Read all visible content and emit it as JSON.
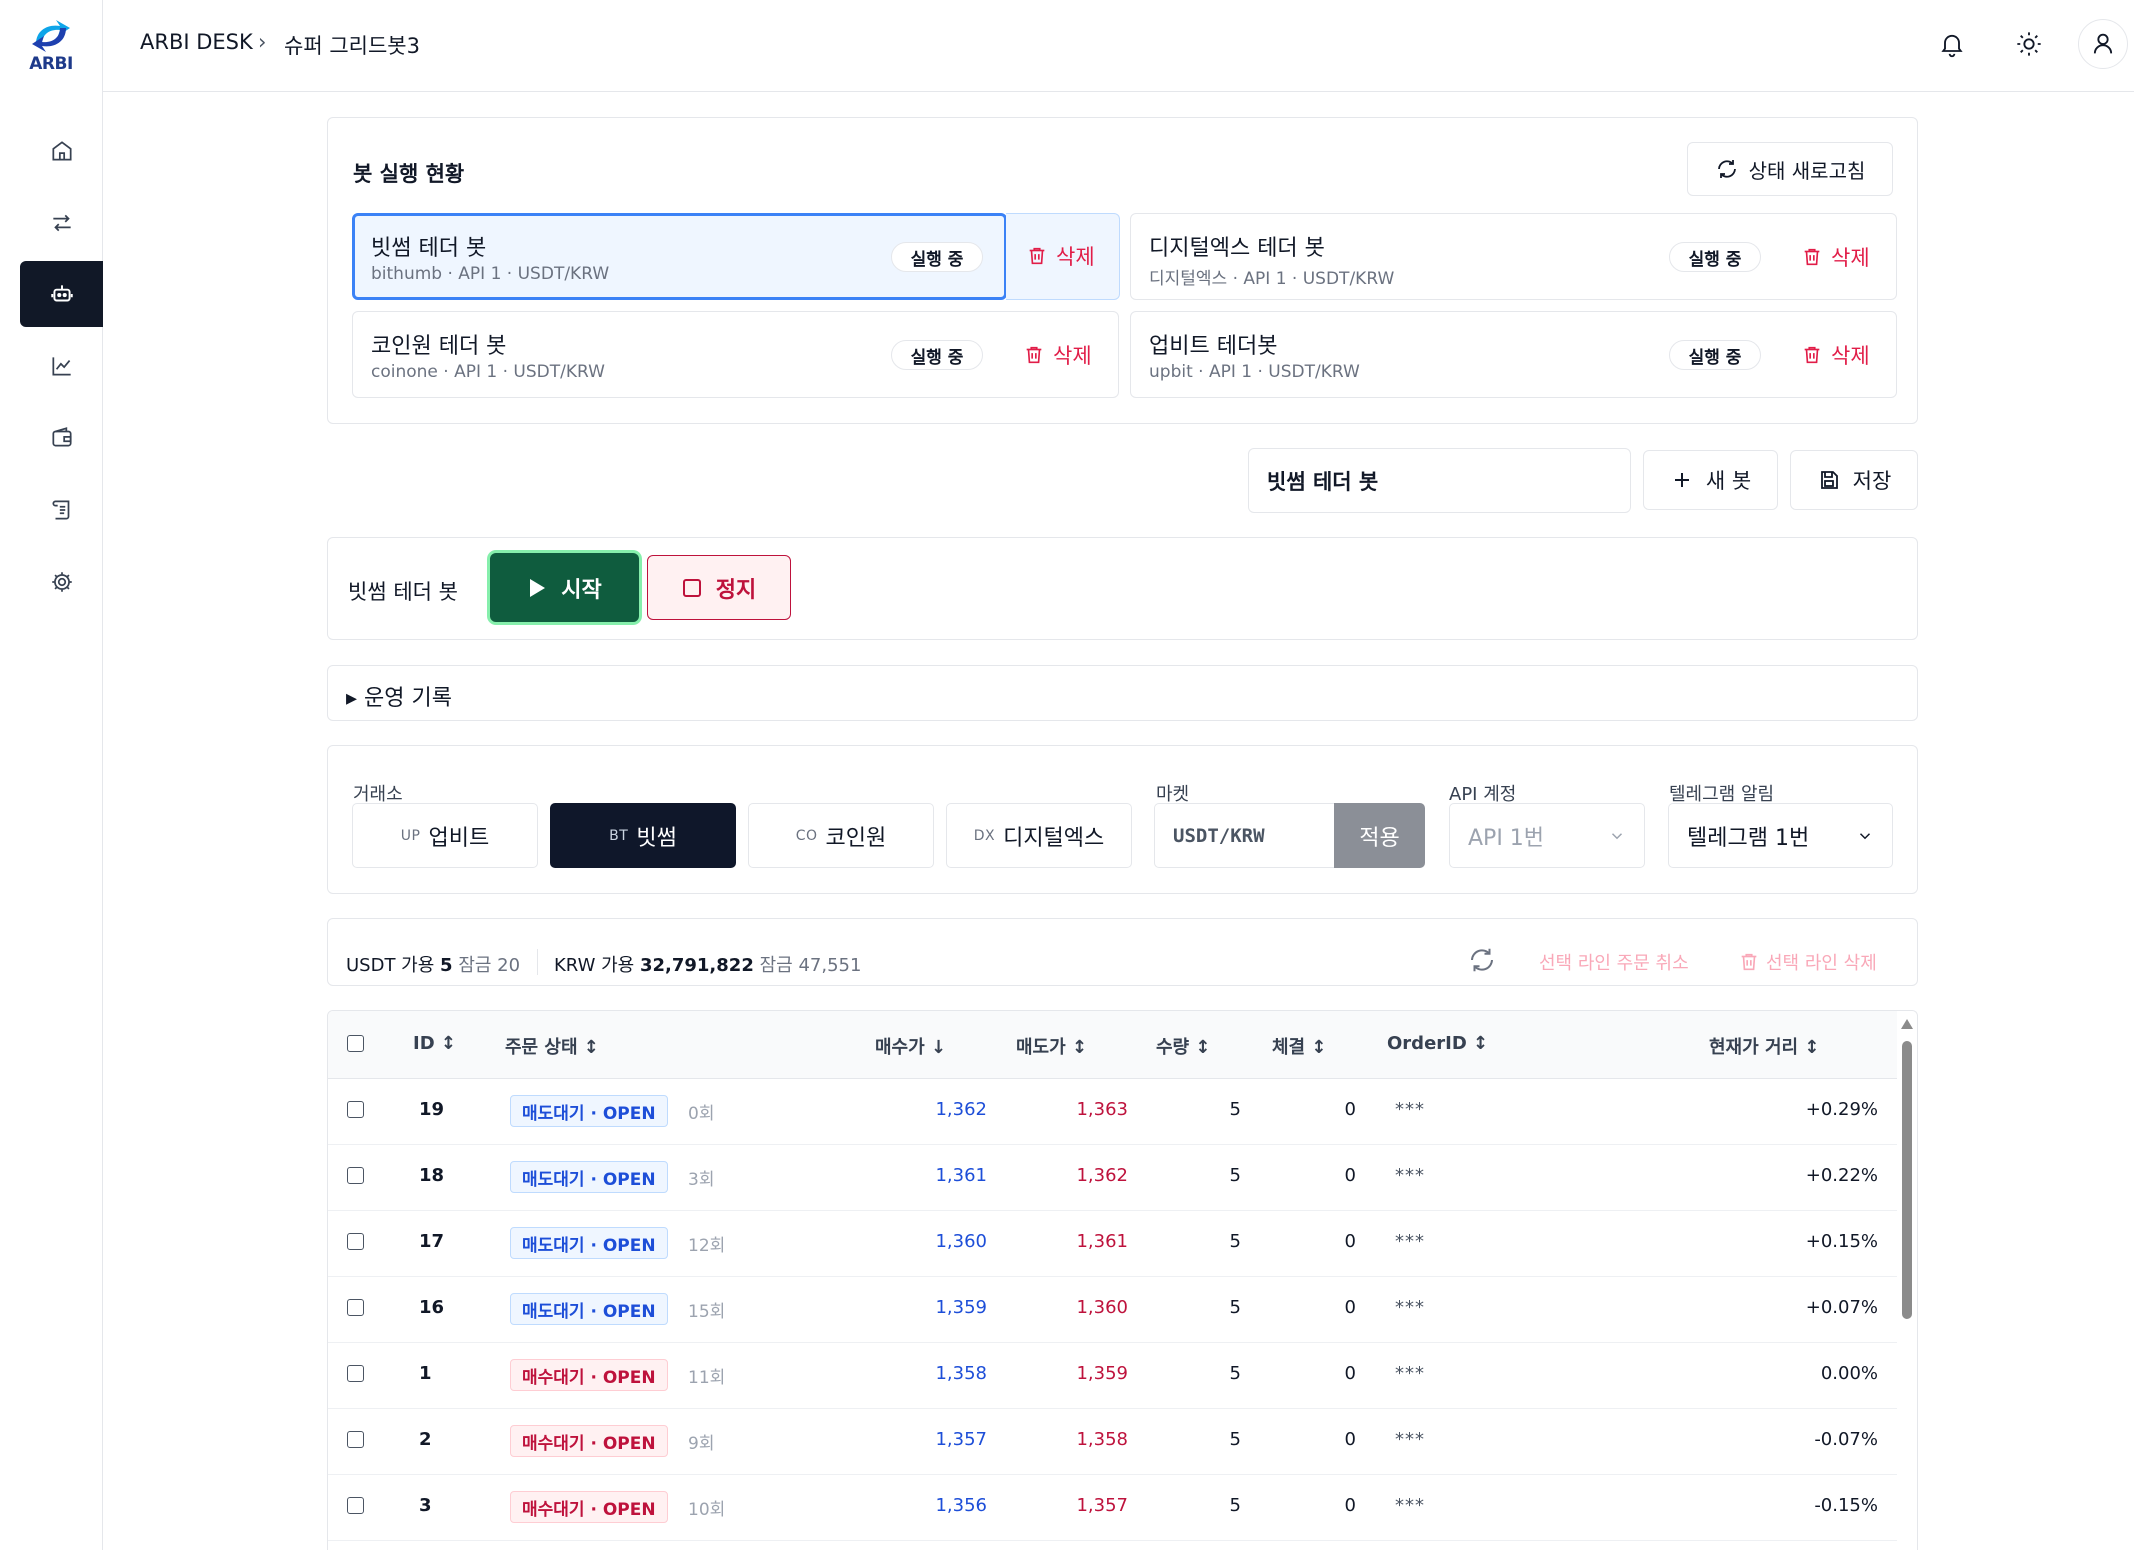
{
  "brand": {
    "logo_text": "ARBI"
  },
  "header": {
    "app_name": "ARBI DESK",
    "page": "슈퍼 그리드봇3"
  },
  "status_panel": {
    "title": "봇 실행 현황",
    "refresh_label": "상태 새로고침",
    "bots": [
      {
        "name": "빗썸 테더 봇",
        "sub": "bithumb · API 1 · USDT/KRW",
        "status": "실행 중",
        "delete": "삭제",
        "selected": true
      },
      {
        "name": "디지털엑스 테더 봇",
        "sub": "디지털엑스 · API 1 · USDT/KRW",
        "status": "실행 중",
        "delete": "삭제",
        "selected": false
      },
      {
        "name": "코인원 테더 봇",
        "sub": "coinone · API 1 · USDT/KRW",
        "status": "실행 중",
        "delete": "삭제",
        "selected": false
      },
      {
        "name": "업비트 테더봇",
        "sub": "upbit · API 1 · USDT/KRW",
        "status": "실행 중",
        "delete": "삭제",
        "selected": false
      }
    ]
  },
  "toolbar": {
    "bot_name_value": "빗썸 테더 봇",
    "new_bot_label": "새 봇",
    "save_label": "저장"
  },
  "control": {
    "label": "빗썸 테더 봇",
    "start_label": "시작",
    "stop_label": "정지"
  },
  "ops_log": {
    "label": "▸ 운영 기록"
  },
  "settings": {
    "exchange_label": "거래소",
    "exchanges": [
      {
        "code": "UP",
        "name": "업비트",
        "active": false
      },
      {
        "code": "BT",
        "name": "빗썸",
        "active": true
      },
      {
        "code": "CO",
        "name": "코인원",
        "active": false
      },
      {
        "code": "DX",
        "name": "디지털엑스",
        "active": false
      }
    ],
    "market_label": "마켓",
    "market_value": "USDT/KRW",
    "apply_label": "적용",
    "api_label": "API 계정",
    "api_value": "API 1번",
    "telegram_label": "텔레그램 알림",
    "telegram_value": "텔레그램 1번"
  },
  "balance": {
    "usdt_label": "USDT 가용",
    "usdt_avail": "5",
    "usdt_lock_label": "잠금",
    "usdt_lock": "20",
    "krw_label": "KRW 가용",
    "krw_avail": "32,791,822",
    "krw_lock_label": "잠금",
    "krw_lock": "47,551",
    "cancel_label": "선택 라인 주문 취소",
    "delete_label": "선택 라인 삭제"
  },
  "table": {
    "headers": {
      "id": "ID ↕",
      "status": "주문 상태 ↕",
      "buy": "매수가 ↓",
      "sell": "매도가 ↕",
      "qty": "수량 ↕",
      "filled": "체결 ↕",
      "order_id": "OrderID ↕",
      "distance": "현재가 거리 ↕"
    },
    "rows": [
      {
        "id": "19",
        "status": "매도대기 · OPEN",
        "type": "sell",
        "count": "0회",
        "buy": "1,362",
        "sell": "1,363",
        "qty": "5",
        "filled": "0",
        "order_id": "***",
        "distance": "+0.29%"
      },
      {
        "id": "18",
        "status": "매도대기 · OPEN",
        "type": "sell",
        "count": "3회",
        "buy": "1,361",
        "sell": "1,362",
        "qty": "5",
        "filled": "0",
        "order_id": "***",
        "distance": "+0.22%"
      },
      {
        "id": "17",
        "status": "매도대기 · OPEN",
        "type": "sell",
        "count": "12회",
        "buy": "1,360",
        "sell": "1,361",
        "qty": "5",
        "filled": "0",
        "order_id": "***",
        "distance": "+0.15%"
      },
      {
        "id": "16",
        "status": "매도대기 · OPEN",
        "type": "sell",
        "count": "15회",
        "buy": "1,359",
        "sell": "1,360",
        "qty": "5",
        "filled": "0",
        "order_id": "***",
        "distance": "+0.07%"
      },
      {
        "id": "1",
        "status": "매수대기 · OPEN",
        "type": "buy",
        "count": "11회",
        "buy": "1,358",
        "sell": "1,359",
        "qty": "5",
        "filled": "0",
        "order_id": "***",
        "distance": "0.00%"
      },
      {
        "id": "2",
        "status": "매수대기 · OPEN",
        "type": "buy",
        "count": "9회",
        "buy": "1,357",
        "sell": "1,358",
        "qty": "5",
        "filled": "0",
        "order_id": "***",
        "distance": "-0.07%"
      },
      {
        "id": "3",
        "status": "매수대기 · OPEN",
        "type": "buy",
        "count": "10회",
        "buy": "1,356",
        "sell": "1,357",
        "qty": "5",
        "filled": "0",
        "order_id": "***",
        "distance": "-0.15%"
      }
    ]
  },
  "colors": {
    "accent_green": "#0f5c3e",
    "danger": "#e11d48",
    "sell_blue": "#1d4ed8",
    "buy_red": "#be123c"
  }
}
